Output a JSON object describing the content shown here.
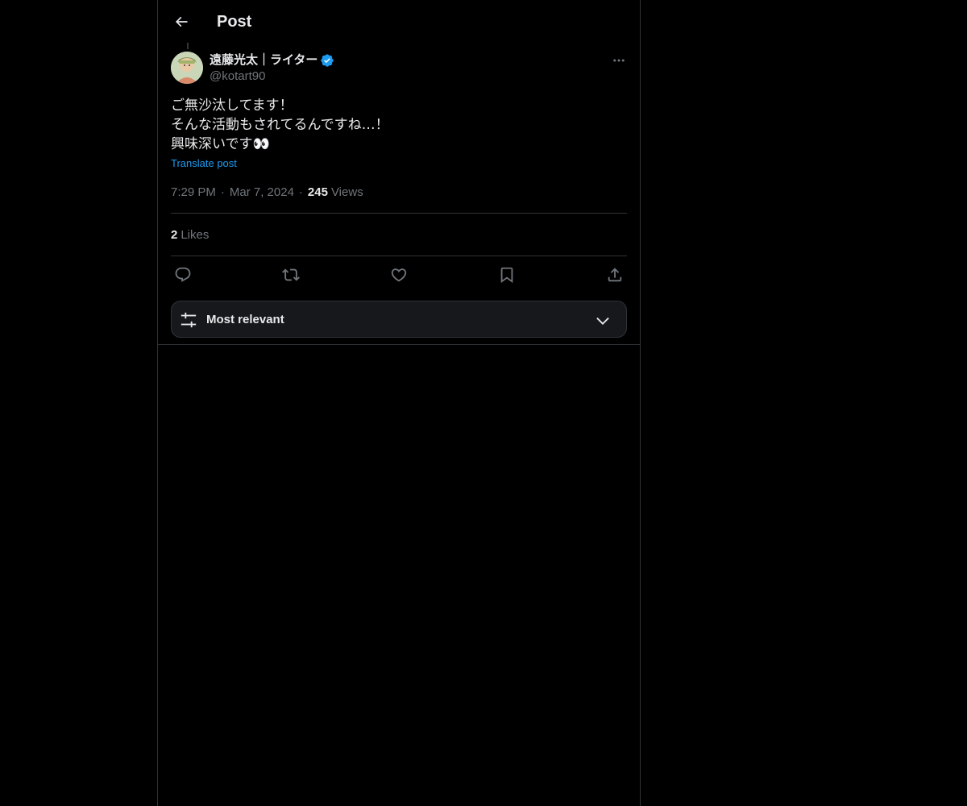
{
  "header": {
    "title": "Post",
    "back_icon": "arrow-left-icon"
  },
  "post": {
    "author": {
      "display_name": "遠藤光太｜ライター",
      "handle": "@kotart90",
      "verified_color": "#1d9bf0"
    },
    "text_lines": [
      "ご無沙汰してます！",
      "そんな活動もされてるんですね…！",
      "興味深いです👀"
    ],
    "translate_label": "Translate post",
    "time": "7:29 PM",
    "separator": "·",
    "date": "Mar 7, 2024",
    "views_count": "245",
    "views_label": "Views",
    "likes_count": "2",
    "likes_label": "Likes"
  },
  "actions": {
    "reply_icon": "reply-icon",
    "repost_icon": "repost-icon",
    "like_icon": "heart-icon",
    "bookmark_icon": "bookmark-icon",
    "share_icon": "share-icon"
  },
  "sort": {
    "label": "Most relevant",
    "icon": "sliders-icon",
    "chevron": "chevron-down-icon"
  },
  "colors": {
    "background": "#000000",
    "text": "#e7e9ea",
    "muted": "#71767b",
    "accent": "#1d9bf0",
    "border": "#2f3336"
  }
}
